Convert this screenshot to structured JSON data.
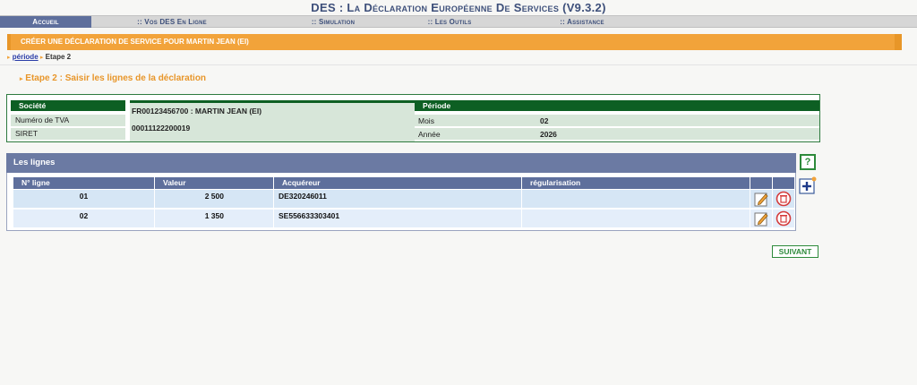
{
  "app": {
    "title": "DES : La Déclaration Européenne De Services (V9.3.2)"
  },
  "nav": {
    "items": [
      {
        "label": "Accueil",
        "active": true
      },
      {
        "label": ":: Vos DES En Ligne",
        "active": false
      },
      {
        "label": ":: Simulation",
        "active": false
      },
      {
        "label": ":: Les Outils",
        "active": false
      },
      {
        "label": ":: Assistance",
        "active": false
      }
    ]
  },
  "banner": {
    "text": "CRÉER UNE DÉCLARATION DE SERVICE POUR MARTIN JEAN (EI)"
  },
  "breadcrumb": {
    "link": "période",
    "current": "Etape 2"
  },
  "step": {
    "title": "Etape 2 : Saisir les lignes de la déclaration"
  },
  "company": {
    "header": "Société",
    "tva_label": "Numéro de TVA",
    "siret_label": "SIRET",
    "tva_value": "FR00123456700 : MARTIN JEAN (EI)",
    "siret_value": "00011122200019"
  },
  "period": {
    "header": "Période",
    "month_label": "Mois",
    "month_value": "02",
    "year_label": "Année",
    "year_value": "2026"
  },
  "lines": {
    "title": "Les lignes",
    "columns": [
      "N° ligne",
      "Valeur",
      "Acquéreur",
      "régularisation"
    ],
    "rows": [
      {
        "num": "01",
        "value": "2 500",
        "buyer": "DE320246011",
        "regularisation": ""
      },
      {
        "num": "02",
        "value": "1 350",
        "buyer": "SE556633303401",
        "regularisation": ""
      }
    ]
  },
  "buttons": {
    "help": "?",
    "next": "SUIVANT"
  },
  "colors": {
    "accent_orange": "#f2a33a",
    "nav_blue": "#5e6f9c",
    "green": "#0d5f23"
  }
}
